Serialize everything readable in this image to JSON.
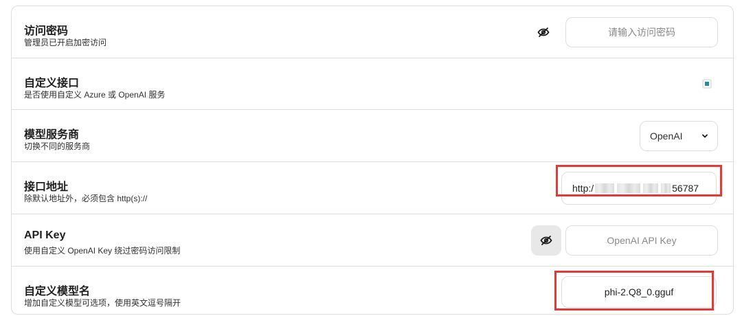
{
  "rows": [
    {
      "title": "访问密码",
      "sub": "管理员已开启加密访问",
      "placeholder": "请输入访问密码"
    },
    {
      "title": "自定义接口",
      "sub": "是否使用自定义 Azure 或 OpenAI 服务",
      "checked": true
    },
    {
      "title": "模型服务商",
      "sub": "切换不同的服务商",
      "selected": "OpenAI"
    },
    {
      "title": "接口地址",
      "sub": "除默认地址外，必须包含 http(s)://",
      "value_prefix": "http:/",
      "value_suffix": "56787"
    },
    {
      "title": "API Key",
      "sub": "使用自定义 OpenAI Key 绕过密码访问限制",
      "placeholder": "OpenAI API Key"
    },
    {
      "title": "自定义模型名",
      "sub": "增加自定义模型可选项，使用英文逗号隔开",
      "value": "phi-2.Q8_0.gguf"
    }
  ],
  "colors": {
    "accent": "#1f8fa8",
    "highlight": "#e53935",
    "border": "#dedede"
  },
  "icons": {
    "eye_off": "eye-off-icon",
    "chevron": "chevron-down-icon"
  }
}
